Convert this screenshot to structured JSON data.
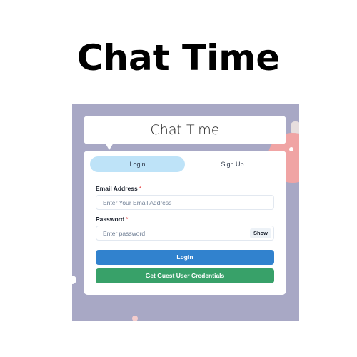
{
  "page": {
    "title": "Chat Time"
  },
  "app": {
    "header_title": "Chat Time",
    "tabs": {
      "login": "Login",
      "signup": "Sign Up"
    },
    "form": {
      "email_label": "Email Address",
      "email_required": "*",
      "email_placeholder": "Enter Your Email Address",
      "password_label": "Password",
      "password_required": "*",
      "password_placeholder": "Enter password",
      "show_label": "Show",
      "login_button": "Login",
      "guest_button": "Get Guest User Credentials"
    }
  },
  "colors": {
    "background": "#a8a8c5",
    "tab_active": "#bee3f8",
    "login_button": "#3182ce",
    "guest_button": "#38a169",
    "required": "#e53e3e"
  }
}
